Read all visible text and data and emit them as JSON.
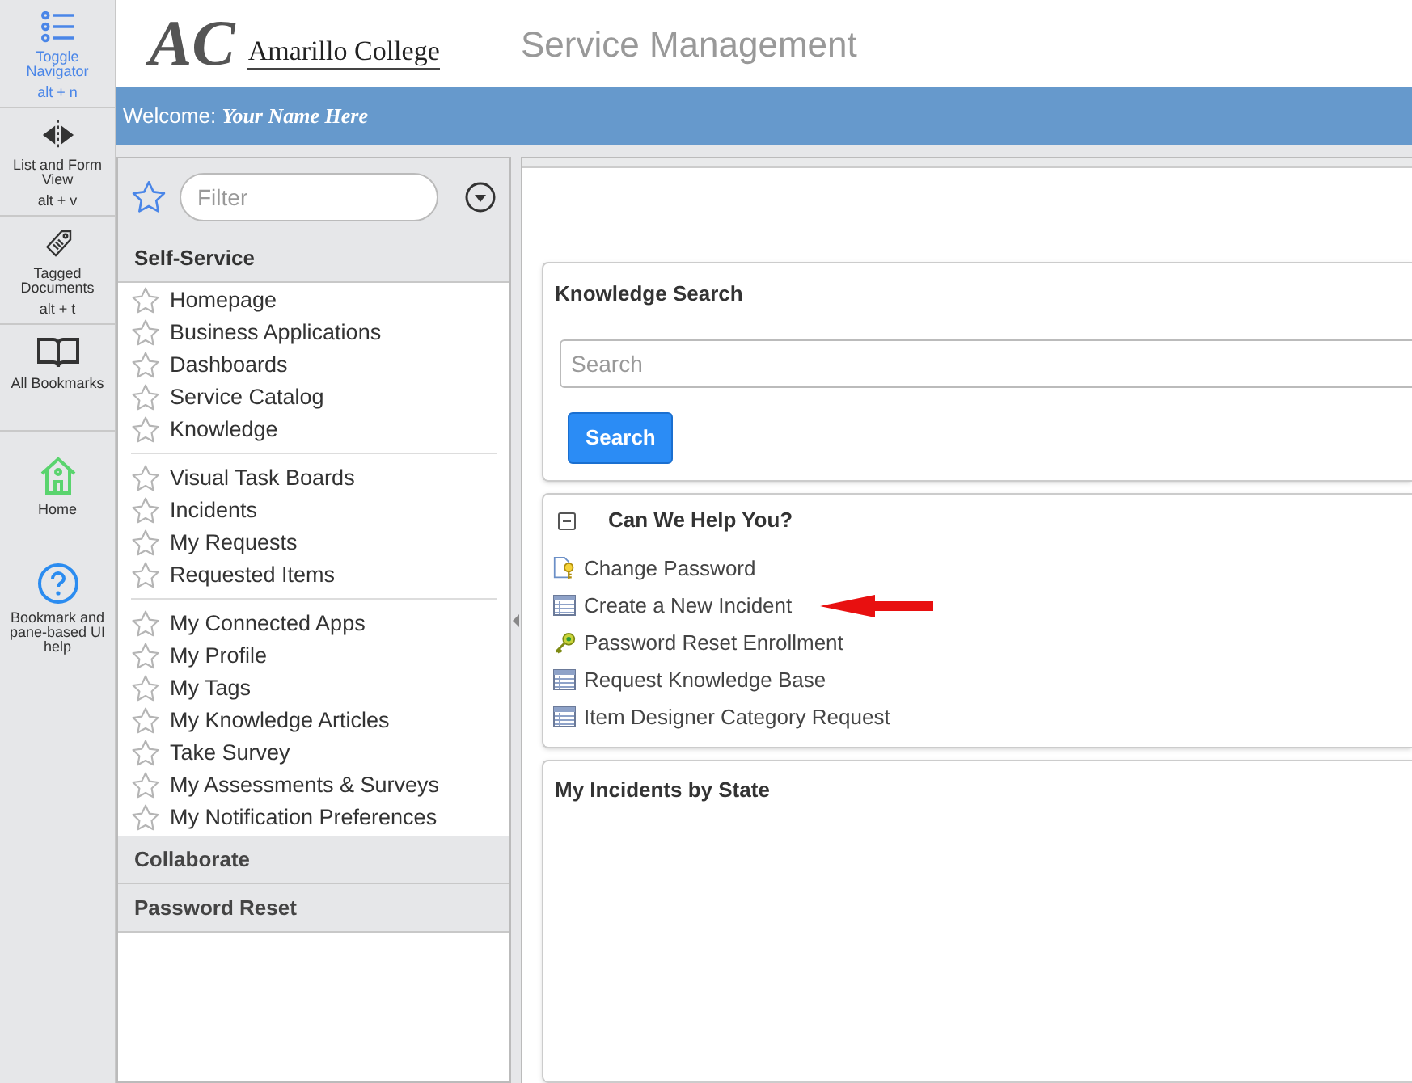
{
  "rail": [
    {
      "kind": "list",
      "label": "Toggle Navigator",
      "shortcut": "alt + n",
      "selected": true
    },
    {
      "kind": "split",
      "label": "List and Form View",
      "shortcut": "alt + v",
      "selected": false
    },
    {
      "kind": "tag",
      "label": "Tagged Documents",
      "shortcut": "alt + t",
      "selected": false
    },
    {
      "kind": "book",
      "label": "All Bookmarks",
      "selected": false
    },
    {
      "kind": "home",
      "label": "Home",
      "selected": false
    },
    {
      "kind": "help",
      "label": "Bookmark and pane-based UI help",
      "selected": false
    }
  ],
  "header": {
    "logo_mark": "AC",
    "logo_name": "Amarillo College",
    "title": "Service Management"
  },
  "welcome": {
    "label": "Welcome:",
    "name": "Your Name Here"
  },
  "navigator": {
    "filter_placeholder": "Filter",
    "sections": [
      {
        "title": "Self-Service",
        "expanded": true,
        "groups": [
          [
            "Homepage",
            "Business Applications",
            "Dashboards",
            "Service Catalog",
            "Knowledge"
          ],
          [
            "Visual Task Boards",
            "Incidents",
            "My Requests",
            "Requested Items"
          ],
          [
            "My Connected Apps",
            "My Profile",
            "My Tags",
            "My Knowledge Articles",
            "Take Survey",
            "My Assessments & Surveys",
            "My Notification Preferences"
          ]
        ]
      },
      {
        "title": "Collaborate",
        "expanded": false
      },
      {
        "title": "Password Reset",
        "expanded": false
      }
    ]
  },
  "knowledge_search": {
    "title": "Knowledge Search",
    "placeholder": "Search",
    "button": "Search"
  },
  "help_panel": {
    "title": "Can We Help You?",
    "expanded": true,
    "links": [
      {
        "kind": "key-doc",
        "label": "Change Password",
        "arrow": false
      },
      {
        "kind": "table",
        "label": "Create a New Incident",
        "arrow": true
      },
      {
        "kind": "key",
        "label": "Password Reset Enrollment",
        "arrow": false
      },
      {
        "kind": "table",
        "label": "Request Knowledge Base",
        "arrow": false
      },
      {
        "kind": "table",
        "label": "Item Designer Category Request",
        "arrow": false
      }
    ]
  },
  "incidents_panel": {
    "title": "My Incidents by State"
  }
}
